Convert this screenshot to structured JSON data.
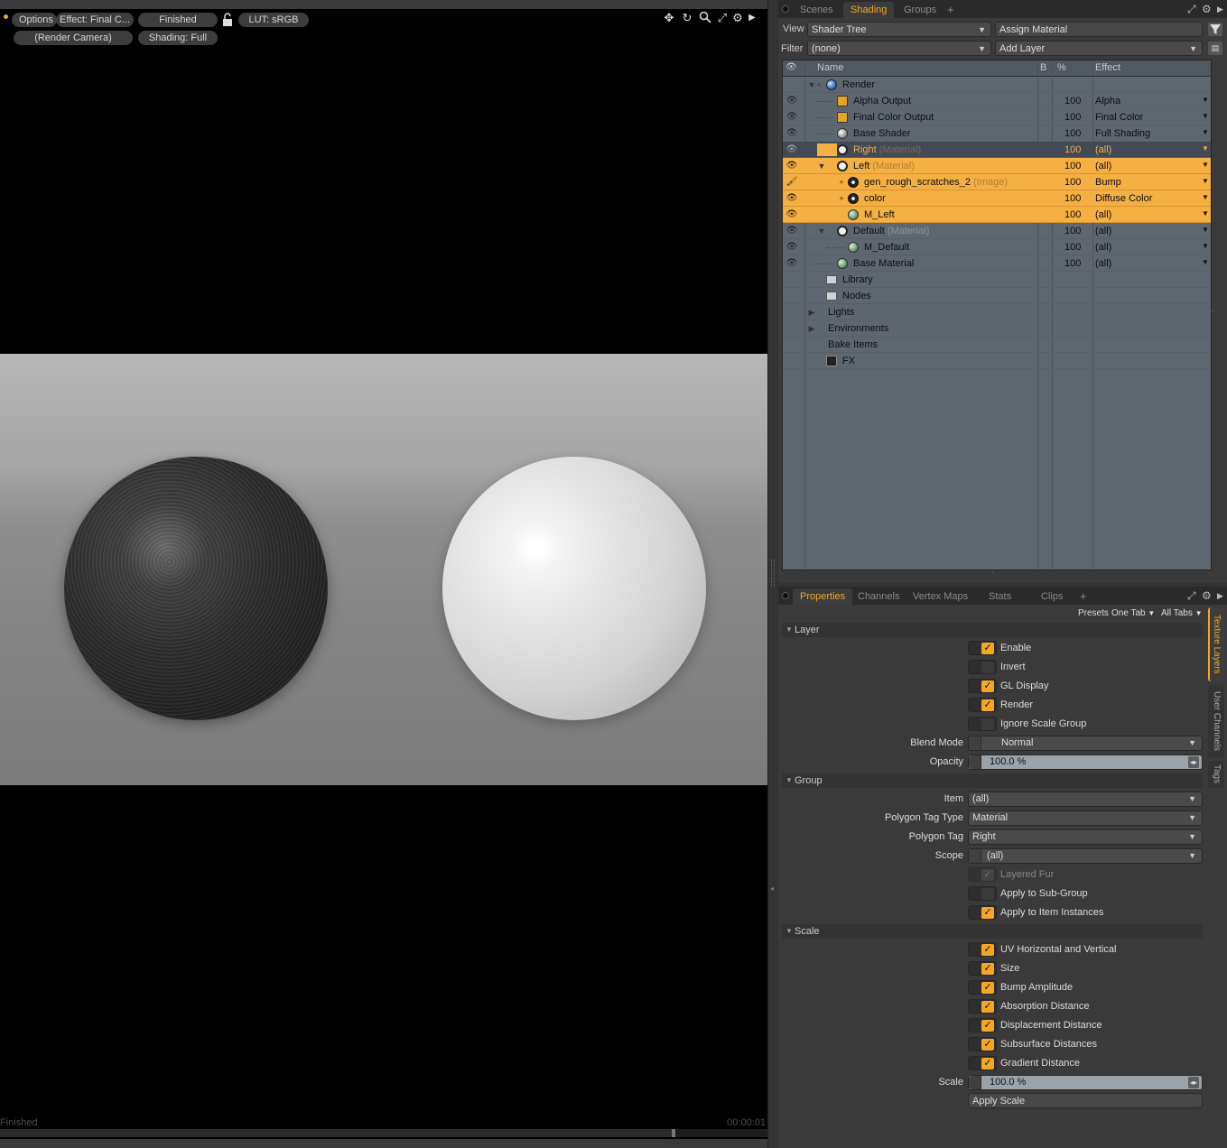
{
  "viewport": {
    "options_label": "Options",
    "effect_label": "Effect: Final C...",
    "status_label": "Finished",
    "lut_label": "LUT: sRGB",
    "camera_label": "(Render Camera)",
    "shading_label": "Shading: Full",
    "footer_status": "Finished",
    "footer_time": "00:00:01",
    "progress_fraction": 0.875
  },
  "top_tabs": {
    "tabs": [
      "Scenes",
      "Shading",
      "Groups"
    ],
    "active": "Shading"
  },
  "shader_panel": {
    "view_label": "View",
    "view_value": "Shader Tree",
    "assign_material": "Assign Material",
    "filter_label": "Filter",
    "filter_value": "(none)",
    "add_layer": "Add Layer",
    "columns": {
      "name": "Name",
      "b": "B",
      "pct": "%",
      "effect": "Effect"
    },
    "rows": [
      {
        "name": "Render",
        "tag": "",
        "pct": "",
        "effect": ""
      },
      {
        "name": "Alpha Output",
        "tag": "",
        "pct": "100",
        "effect": "Alpha"
      },
      {
        "name": "Final Color Output",
        "tag": "",
        "pct": "100",
        "effect": "Final Color"
      },
      {
        "name": "Base Shader",
        "tag": "",
        "pct": "100",
        "effect": "Full Shading"
      },
      {
        "name": "Right",
        "tag": "(Material)",
        "pct": "100",
        "effect": "(all)"
      },
      {
        "name": "Left",
        "tag": "(Material)",
        "pct": "100",
        "effect": "(all)"
      },
      {
        "name": "gen_rough_scratches_2",
        "tag": "(Image)",
        "pct": "100",
        "effect": "Bump"
      },
      {
        "name": "color",
        "tag": "",
        "pct": "100",
        "effect": "Diffuse Color"
      },
      {
        "name": "M_Left",
        "tag": "",
        "pct": "100",
        "effect": "(all)"
      },
      {
        "name": "Default",
        "tag": "(Material)",
        "pct": "100",
        "effect": "(all)"
      },
      {
        "name": "M_Default",
        "tag": "",
        "pct": "100",
        "effect": "(all)"
      },
      {
        "name": "Base Material",
        "tag": "",
        "pct": "100",
        "effect": "(all)"
      },
      {
        "name": "Library",
        "tag": "",
        "pct": "",
        "effect": ""
      },
      {
        "name": "Nodes",
        "tag": "",
        "pct": "",
        "effect": ""
      },
      {
        "name": "Lights",
        "tag": "",
        "pct": "",
        "effect": ""
      },
      {
        "name": "Environments",
        "tag": "",
        "pct": "",
        "effect": ""
      },
      {
        "name": "Bake Items",
        "tag": "",
        "pct": "",
        "effect": ""
      },
      {
        "name": "FX",
        "tag": "",
        "pct": "",
        "effect": ""
      }
    ]
  },
  "props_tabs": {
    "tabs": [
      "Properties",
      "Channels",
      "Vertex Maps",
      "Stats",
      "Clips"
    ],
    "active": "Properties",
    "presets": "Presets",
    "one_tab": "One Tab",
    "all_tabs": "All Tabs"
  },
  "side_tabs": [
    "Texture Layers",
    "User Channels",
    "Tags"
  ],
  "properties": {
    "layer": {
      "header": "Layer",
      "enable": "Enable",
      "invert": "Invert",
      "gl_display": "GL Display",
      "render": "Render",
      "ignore_scale_group": "Ignore Scale Group",
      "blend_mode_label": "Blend Mode",
      "blend_mode_value": "Normal",
      "opacity_label": "Opacity",
      "opacity_value": "100.0 %"
    },
    "group": {
      "header": "Group",
      "item_label": "Item",
      "item_value": "(all)",
      "polygon_tag_type_label": "Polygon Tag Type",
      "polygon_tag_type_value": "Material",
      "polygon_tag_label": "Polygon Tag",
      "polygon_tag_value": "Right",
      "scope_label": "Scope",
      "scope_value": "(all)",
      "layered_fur": "Layered Fur",
      "apply_sub_group": "Apply to Sub-Group",
      "apply_item_instances": "Apply to Item Instances"
    },
    "scale": {
      "header": "Scale",
      "uv_hv": "UV Horizontal and Vertical",
      "size": "Size",
      "bump_amplitude": "Bump Amplitude",
      "absorption_distance": "Absorption Distance",
      "displacement_distance": "Displacement Distance",
      "subsurface_distances": "Subsurface Distances",
      "gradient_distance": "Gradient Distance",
      "scale_label": "Scale",
      "scale_value": "100.0 %",
      "apply_scale": "Apply Scale"
    }
  },
  "colors": {
    "accent": "#f5a623",
    "selection": "#f5b043",
    "tree_bg": "#5e6770"
  }
}
